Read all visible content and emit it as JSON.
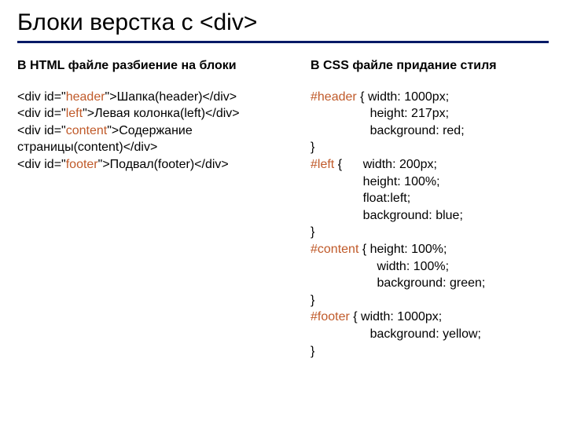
{
  "title": "Блоки верстка с <div>",
  "left": {
    "heading": "В HTML файле разбиение на блоки",
    "l1_a": "<div id=\"",
    "l1_b": "header",
    "l1_c": "\">Шапка(header)</div>",
    "l2_a": "<div id=\"",
    "l2_b": "left",
    "l2_c": "\">Левая колонка(left)</div>",
    "l3_a": "<div id=\"",
    "l3_b": "content",
    "l3_c": "\">Содержание",
    "l3_d": "страницы(content)</div>",
    "l4_a": "<div id=\"",
    "l4_b": "footer",
    "l4_c": "\">Подвал(footer)</div>"
  },
  "right": {
    "heading": "В CSS файле придание стиля",
    "s1_sel": "#header",
    "s1_l1": " { width: 1000px;",
    "s1_l2": "                 height: 217px;",
    "s1_l3": "                 background: red;",
    "close1": "}",
    "s2_sel": "#left",
    "s2_l1": " {      width: 200px;",
    "s2_l2": "               height: 100%;",
    "s2_l3": "               float:left;",
    "s2_l4": "               background: blue;",
    "close2": "}",
    "s3_sel": "#content",
    "s3_l1": " { height: 100%;",
    "s3_l2": "                   width: 100%;",
    "s3_l3": "                   background: green;",
    "close3": "}",
    "s4_sel": "#footer",
    "s4_l1": " { width: 1000px;",
    "s4_l2": "                 background: yellow;",
    "close4": "}"
  }
}
